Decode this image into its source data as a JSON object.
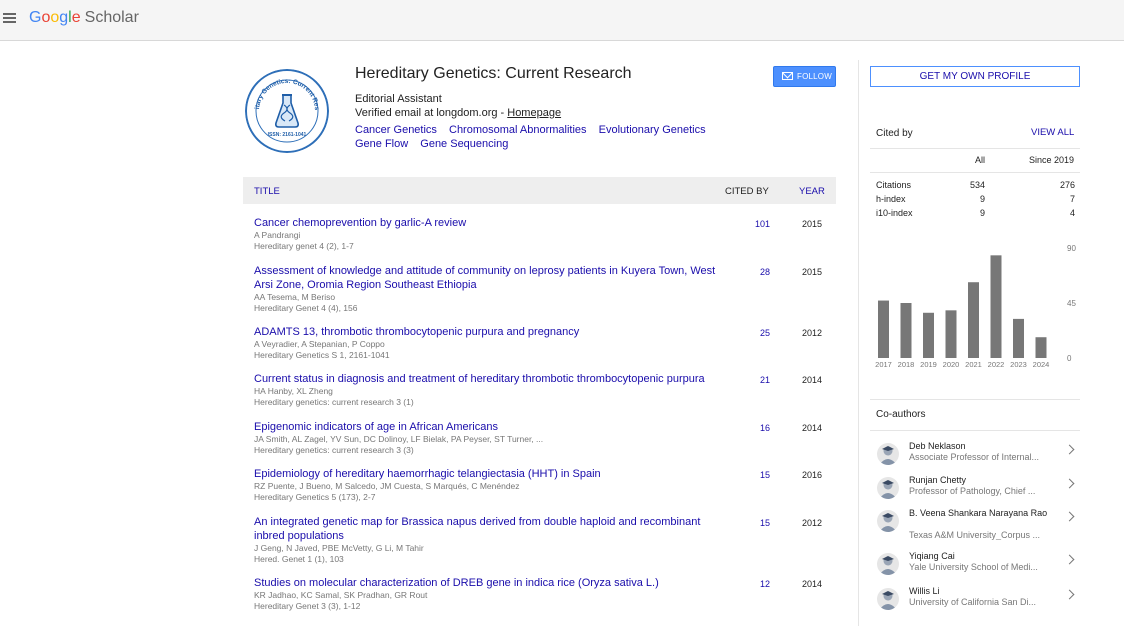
{
  "topbar": {
    "logo_google": "Google",
    "logo_scholar": "Scholar"
  },
  "profile": {
    "name": "Hereditary Genetics: Current Research",
    "affiliation": "Editorial Assistant",
    "email_text": "Verified email at longdom.org - ",
    "homepage_label": "Homepage",
    "logo_text_top": "Hereditary Genetics: Current Research",
    "logo_issn": "ISSN: 2161-1041",
    "interests": [
      "Cancer Genetics",
      "Chromosomal Abnormalities",
      "Evolutionary Genetics",
      "Gene Flow",
      "Gene Sequencing"
    ],
    "follow_label": "FOLLOW",
    "get_profile_label": "GET MY OWN PROFILE"
  },
  "table": {
    "col_title": "TITLE",
    "col_cited": "CITED BY",
    "col_year": "YEAR",
    "rows": [
      {
        "title": "Cancer chemoprevention by garlic-A review",
        "authors": "A Pandrangi",
        "venue": "Hereditary genet 4 (2), 1-7",
        "cites": "101",
        "year": "2015"
      },
      {
        "title": "Assessment of knowledge and attitude of community on leprosy patients in Kuyera Town, West Arsi Zone, Oromia Region Southeast Ethiopia",
        "authors": "AA Tesema, M Beriso",
        "venue": "Hereditary Genet 4 (4), 156",
        "cites": "28",
        "year": "2015"
      },
      {
        "title": "ADAMTS 13, thrombotic thrombocytopenic purpura and pregnancy",
        "authors": "A Veyradier, A Stepanian, P Coppo",
        "venue": "Hereditary Genetics S 1, 2161-1041",
        "cites": "25",
        "year": "2012"
      },
      {
        "title": "Current status in diagnosis and treatment of hereditary thrombotic thrombocytopenic purpura",
        "authors": "HA Hanby, XL Zheng",
        "venue": "Hereditary genetics: current research 3 (1)",
        "cites": "21",
        "year": "2014"
      },
      {
        "title": "Epigenomic indicators of age in African Americans",
        "authors": "JA Smith, AL Zagel, YV Sun, DC Dolinoy, LF Bielak, PA Peyser, ST Turner, ...",
        "venue": "Hereditary genetics: current research 3 (3)",
        "cites": "16",
        "year": "2014"
      },
      {
        "title": "Epidemiology of hereditary haemorrhagic telangiectasia (HHT) in Spain",
        "authors": "RZ Puente, J Bueno, M Salcedo, JM Cuesta, S Marqués, C Menéndez",
        "venue": "Hereditary Genetics 5 (173), 2-7",
        "cites": "15",
        "year": "2016"
      },
      {
        "title": "An integrated genetic map for Brassica napus derived from double haploid and recombinant inbred populations",
        "authors": "J Geng, N Javed, PBE McVetty, G Li, M Tahir",
        "venue": "Hered. Genet 1 (1), 103",
        "cites": "15",
        "year": "2012"
      },
      {
        "title": "Studies on molecular characterization of DREB gene in indica rice (Oryza sativa L.)",
        "authors": "KR Jadhao, KC Samal, SK Pradhan, GR Rout",
        "venue": "Hereditary Genet 3 (3), 1-12",
        "cites": "12",
        "year": "2014"
      }
    ]
  },
  "cited_by": {
    "heading": "Cited by",
    "view_all": "VIEW ALL",
    "col_all": "All",
    "col_since": "Since 2019",
    "rows": [
      {
        "label": "Citations",
        "all": "534",
        "since": "276"
      },
      {
        "label": "h-index",
        "all": "9",
        "since": "7"
      },
      {
        "label": "i10-index",
        "all": "9",
        "since": "4"
      }
    ]
  },
  "chart_data": {
    "type": "bar",
    "categories": [
      "2017",
      "2018",
      "2019",
      "2020",
      "2021",
      "2022",
      "2023",
      "2024"
    ],
    "values": [
      47,
      45,
      37,
      39,
      62,
      84,
      32,
      17
    ],
    "ylim": [
      0,
      90
    ],
    "yticks": [
      "90",
      "45",
      "0"
    ],
    "bar_color": "#777777"
  },
  "coauthors": {
    "heading": "Co-authors",
    "items": [
      {
        "name": "Deb Neklason",
        "affiliation": "Associate Professor of Internal..."
      },
      {
        "name": "Runjan Chetty",
        "affiliation": "Professor of Pathology, Chief ..."
      },
      {
        "name": "B. Veena Shankara Narayana Rao",
        "affiliation": "Texas A&M University_Corpus ..."
      },
      {
        "name": "Yiqiang Cai",
        "affiliation": "Yale University School of Medi..."
      },
      {
        "name": "Willis Li",
        "affiliation": "University of California San Di..."
      }
    ]
  },
  "colors": {
    "link": "#1a0dab",
    "accent": "#4d90fe"
  }
}
